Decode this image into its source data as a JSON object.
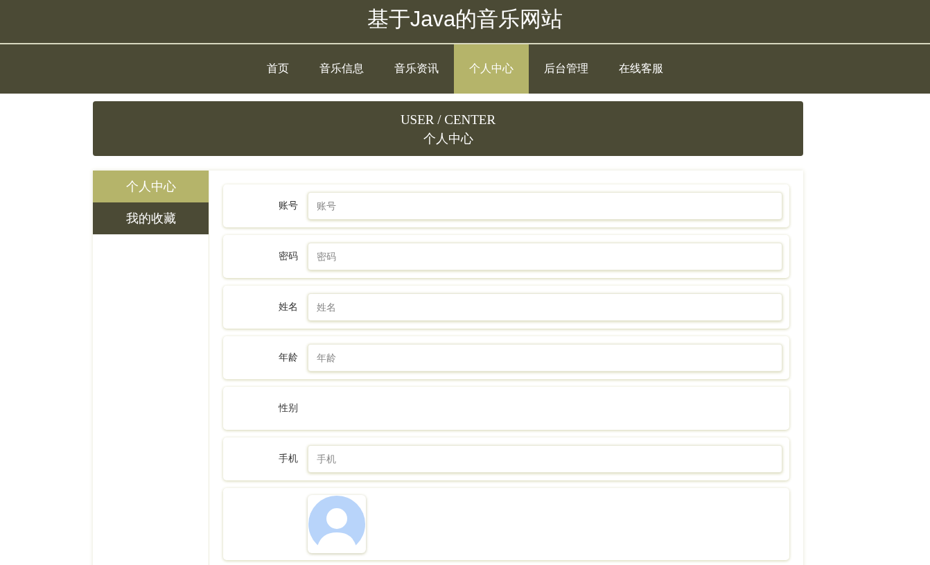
{
  "site_title": "基于Java的音乐网站",
  "nav": [
    {
      "label": "首页",
      "selected": false
    },
    {
      "label": "音乐信息",
      "selected": false
    },
    {
      "label": "音乐资讯",
      "selected": false
    },
    {
      "label": "个人中心",
      "selected": true
    },
    {
      "label": "后台管理",
      "selected": false
    },
    {
      "label": "在线客服",
      "selected": false
    }
  ],
  "banner": {
    "title": "USER / CENTER",
    "subtitle": "个人中心"
  },
  "sidebar": [
    {
      "label": "个人中心",
      "selected": true
    },
    {
      "label": "我的收藏",
      "selected": false
    }
  ],
  "form": [
    {
      "kind": "input",
      "label": "账号",
      "placeholder": "账号"
    },
    {
      "kind": "input",
      "label": "密码",
      "placeholder": "密码"
    },
    {
      "kind": "input",
      "label": "姓名",
      "placeholder": "姓名"
    },
    {
      "kind": "input",
      "label": "年龄",
      "placeholder": "年龄"
    },
    {
      "kind": "empty",
      "label": "性别"
    },
    {
      "kind": "input",
      "label": "手机",
      "placeholder": "手机"
    },
    {
      "kind": "avatar"
    }
  ]
}
